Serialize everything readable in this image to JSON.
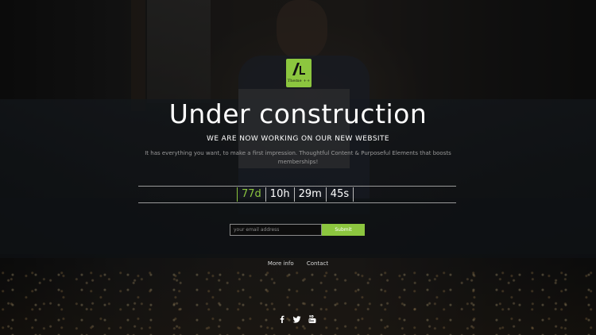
{
  "logo": {
    "text": "Theme ++",
    "color": "#8cc63f"
  },
  "hero": {
    "title": "Under construction",
    "subtitle": "WE ARE NOW WORKING ON OUR NEW WEBSITE",
    "description": "It has everything you want, to make a first impression. Thoughtful Content & Purposeful Elements that boosts memberships!"
  },
  "countdown": {
    "days": "77d",
    "hours": "10h",
    "minutes": "29m",
    "seconds": "45s"
  },
  "subscribe": {
    "email_placeholder": "your email address",
    "submit_label": "Submit"
  },
  "links": {
    "more_info": "More info",
    "contact": "Contact"
  },
  "social": {
    "icons": [
      "facebook-icon",
      "twitter-icon",
      "youtube-icon"
    ]
  },
  "colors": {
    "accent": "#8cc63f"
  }
}
